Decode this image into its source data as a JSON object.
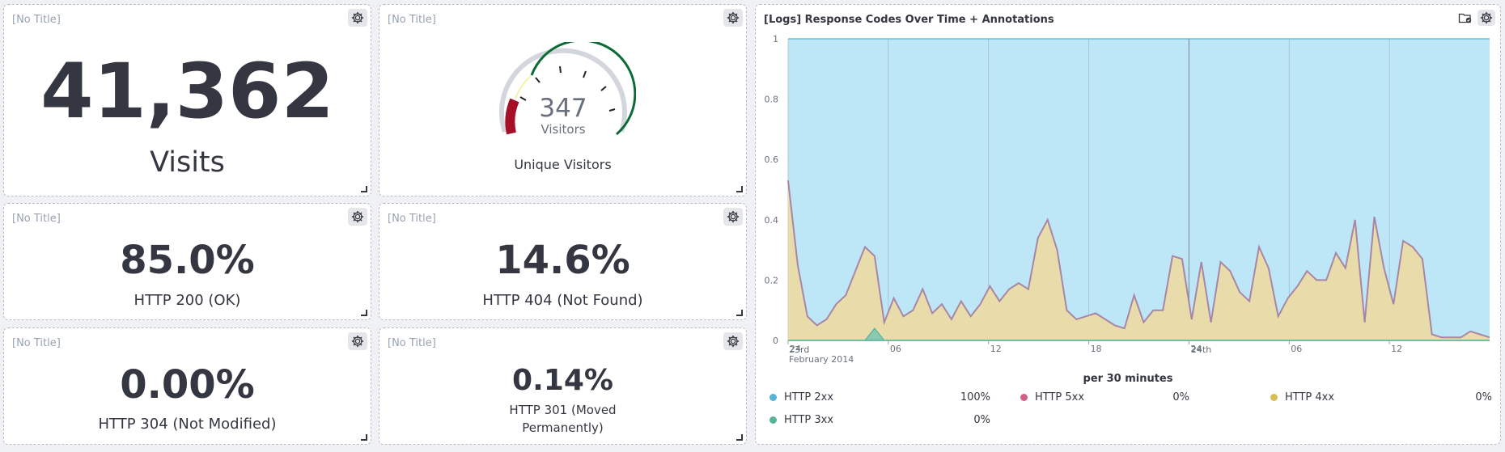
{
  "panels": {
    "visits": {
      "title": "[No Title]",
      "value": "41,362",
      "label": "Visits"
    },
    "unique": {
      "title": "[No Title]",
      "gauge_value": "347",
      "gauge_unit": "Visitors",
      "label": "Unique Visitors",
      "gauge_fraction": 0.69
    },
    "http200": {
      "title": "[No Title]",
      "value": "85.0%",
      "label": "HTTP 200 (OK)"
    },
    "http404": {
      "title": "[No Title]",
      "value": "14.6%",
      "label": "HTTP 404 (Not Found)"
    },
    "http304": {
      "title": "[No Title]",
      "value": "0.00%",
      "label": "HTTP 304 (Not Modified)"
    },
    "http301": {
      "title": "[No Title]",
      "value": "0.14%",
      "label_line1": "HTTP 301 (Moved",
      "label_line2": "Permanently)"
    }
  },
  "chart": {
    "title": "[Logs] Response Codes Over Time + Annotations",
    "xlabel": "per 30 minutes",
    "date_label_1": "23rd",
    "date_label_2": "February 2014",
    "date_label_3": "24th",
    "legend": [
      {
        "name": "HTTP 2xx",
        "value": "100%",
        "color": "#54b3d6"
      },
      {
        "name": "HTTP 5xx",
        "value": "0%",
        "color": "#d36086"
      },
      {
        "name": "HTTP 4xx",
        "value": "0%",
        "color": "#d6bf57"
      },
      {
        "name": "HTTP 3xx",
        "value": "0%",
        "color": "#54b399"
      }
    ]
  },
  "chart_data": {
    "type": "area",
    "title": "[Logs] Response Codes Over Time + Annotations",
    "xlabel": "per 30 minutes",
    "ylim": [
      0,
      1
    ],
    "y_ticks": [
      "0",
      "0.2",
      "0.4",
      "0.6",
      "0.8",
      "1"
    ],
    "x_tick_labels": [
      "24",
      "06",
      "12",
      "18",
      "24",
      "06",
      "12"
    ],
    "x_tick_hours": [
      0,
      6,
      12,
      18,
      24,
      30,
      36
    ],
    "x_start_hour": 0,
    "x_end_hour": 42,
    "stacked": true,
    "series": [
      {
        "name": "HTTP 2xx",
        "color": "#bde7f7",
        "stroke": "#54b3d6",
        "note": "fills to 1"
      },
      {
        "name": "HTTP 4xx",
        "color": "#e8dcaa",
        "stroke": "#a986a6",
        "values": [
          0.53,
          0.25,
          0.08,
          0.05,
          0.07,
          0.12,
          0.15,
          0.23,
          0.31,
          0.28,
          0.06,
          0.14,
          0.08,
          0.1,
          0.17,
          0.09,
          0.12,
          0.07,
          0.13,
          0.08,
          0.12,
          0.18,
          0.13,
          0.17,
          0.19,
          0.17,
          0.34,
          0.4,
          0.3,
          0.1,
          0.07,
          0.08,
          0.09,
          0.07,
          0.05,
          0.04,
          0.15,
          0.06,
          0.1,
          0.1,
          0.28,
          0.27,
          0.07,
          0.26,
          0.06,
          0.26,
          0.23,
          0.16,
          0.13,
          0.31,
          0.24,
          0.08,
          0.14,
          0.18,
          0.23,
          0.2,
          0.2,
          0.29,
          0.24,
          0.4,
          0.06,
          0.41,
          0.24,
          0.12,
          0.33,
          0.31,
          0.27,
          0.02,
          0.01,
          0.01,
          0.01,
          0.03,
          0.02,
          0.01
        ]
      },
      {
        "name": "HTTP 3xx",
        "color": "#8cc9b2",
        "stroke": "#54b399",
        "values": [
          0,
          0,
          0,
          0,
          0,
          0,
          0,
          0,
          0,
          0.04,
          0,
          0,
          0,
          0,
          0,
          0,
          0,
          0,
          0,
          0,
          0,
          0,
          0,
          0,
          0,
          0,
          0,
          0,
          0,
          0,
          0,
          0,
          0,
          0,
          0,
          0,
          0,
          0,
          0,
          0,
          0,
          0,
          0,
          0,
          0,
          0,
          0,
          0,
          0,
          0,
          0,
          0,
          0,
          0,
          0,
          0,
          0,
          0,
          0,
          0,
          0,
          0,
          0,
          0,
          0,
          0,
          0,
          0,
          0,
          0,
          0,
          0,
          0,
          0
        ]
      },
      {
        "name": "HTTP 5xx",
        "color": "#d36086",
        "values": []
      }
    ]
  }
}
